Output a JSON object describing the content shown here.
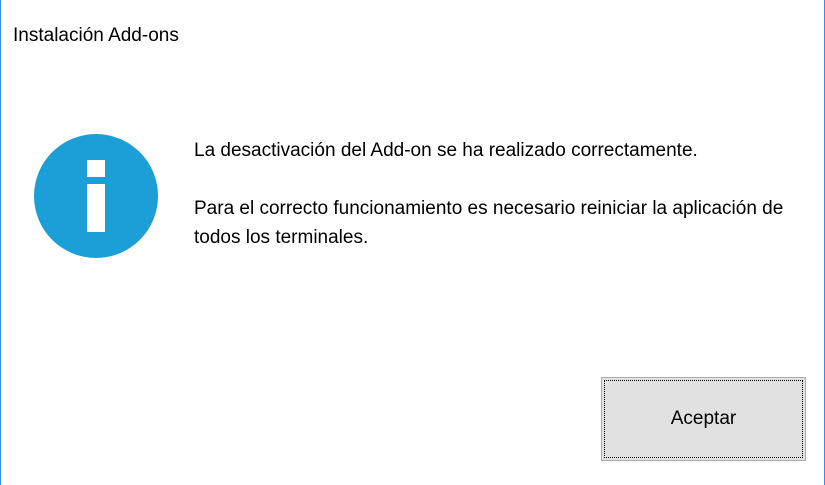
{
  "window": {
    "title": "Instalación Add-ons"
  },
  "icon": {
    "name": "info-icon",
    "color": "#1c9fd6"
  },
  "message": {
    "line1": "La desactivación del Add-on se ha realizado correctamente.",
    "line2": "Para el correcto funcionamiento es necesario reiniciar la aplicación de todos los terminales."
  },
  "buttons": {
    "ok_label": "Aceptar"
  }
}
